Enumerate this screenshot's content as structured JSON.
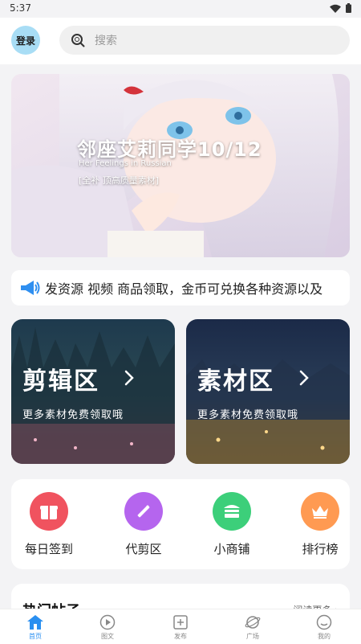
{
  "status": {
    "time": "5:37"
  },
  "header": {
    "login_label": "登录",
    "search_placeholder": "搜索"
  },
  "banner": {
    "title": "邻座艾莉同学10/12",
    "subtitle_en": "Her Feelings in Russian",
    "subtitle_cn": "[全补 顶高质量素材]"
  },
  "notice": {
    "text": "发资源 视频 商品领取，金币可兑换各种资源以及"
  },
  "zones": [
    {
      "title": "剪辑区",
      "subtitle": "更多素材免费领取哦"
    },
    {
      "title": "素材区",
      "subtitle": "更多素材免费领取哦"
    }
  ],
  "quick_links": [
    {
      "label": "每日签到",
      "icon": "gift-box-icon",
      "color": "#f0535f"
    },
    {
      "label": "代剪区",
      "icon": "magic-wand-icon",
      "color": "#b565ee"
    },
    {
      "label": "小商铺",
      "icon": "shop-icon",
      "color": "#3ccf7a"
    },
    {
      "label": "排行榜",
      "icon": "crown-icon",
      "color": "#ff9a52"
    }
  ],
  "hot_posts": {
    "title": "热门帖子",
    "more_label": "阅读更多"
  },
  "bottom_nav": [
    {
      "label": "首页",
      "icon": "home-icon",
      "active": true
    },
    {
      "label": "图文",
      "icon": "play-circle-icon",
      "active": false
    },
    {
      "label": "发布",
      "icon": "plus-square-icon",
      "active": false
    },
    {
      "label": "广场",
      "icon": "planet-icon",
      "active": false
    },
    {
      "label": "我的",
      "icon": "smile-icon",
      "active": false
    }
  ]
}
